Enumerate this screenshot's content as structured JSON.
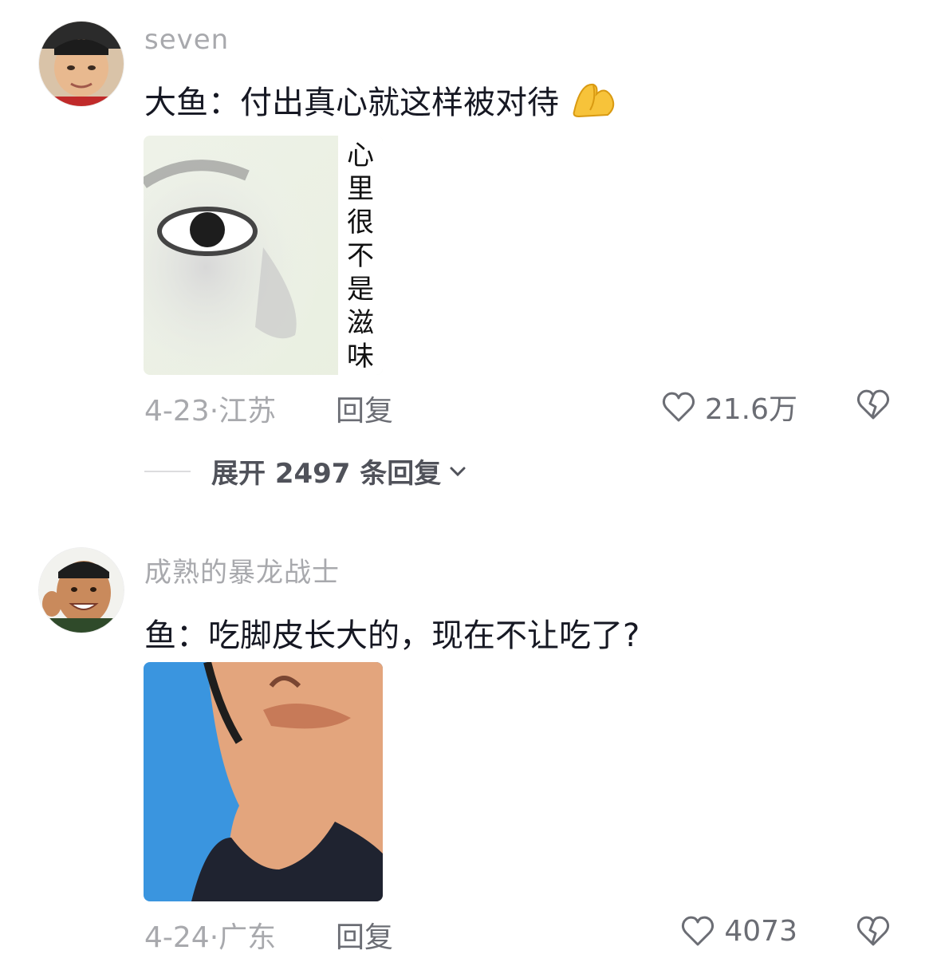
{
  "comments": [
    {
      "username": "seven",
      "text": "大鱼：付出真心就这样被对待",
      "emoji_icon": "pinched-fingers-emoji",
      "image_caption": "心里很不是滋味",
      "date": "4-23",
      "location": "江苏",
      "reply_label": "回复",
      "likes": "21.6万",
      "expand_replies": "展开 2497 条回复"
    },
    {
      "username": "成熟的暴龙战士",
      "text": "鱼：吃脚皮长大的，现在不让吃了?",
      "date": "4-24",
      "location": "广东",
      "reply_label": "回复",
      "likes": "4073"
    }
  ],
  "colors": {
    "muted": "#a8a9ad",
    "text": "#161823",
    "secondary": "#6b6d74",
    "media_blue": "#3a95df"
  }
}
